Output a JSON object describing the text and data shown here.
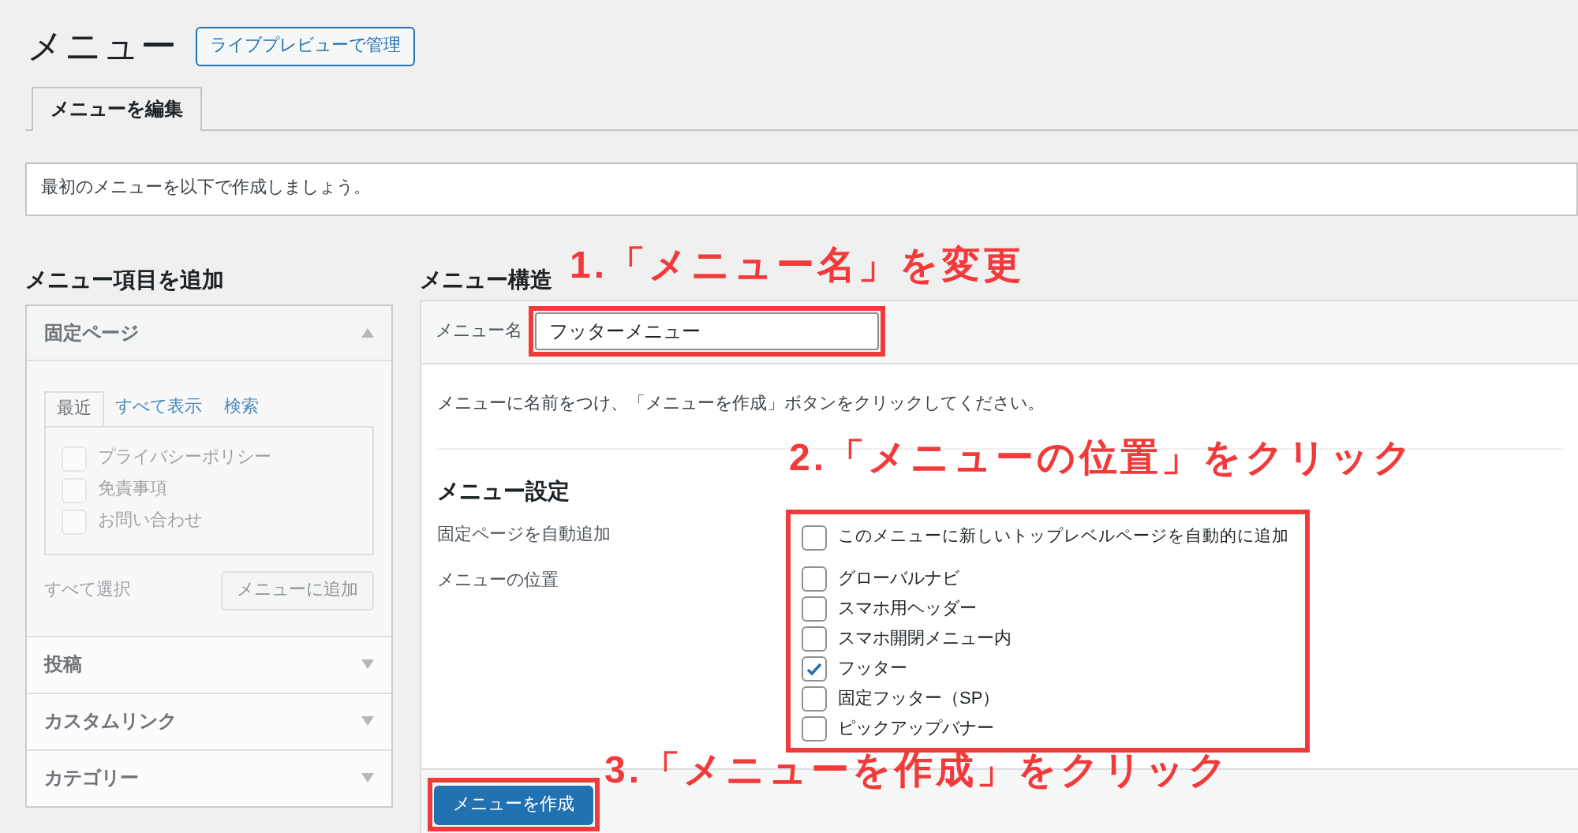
{
  "page_title": "メニュー",
  "live_preview_button": "ライブプレビューで管理",
  "tabs": [
    {
      "label": "メニューを編集",
      "selected": true
    }
  ],
  "notice": "最初のメニューを以下で作成しましょう。",
  "add_items": {
    "heading": "メニュー項目を追加",
    "disabled": true,
    "sections": [
      {
        "title": "固定ページ",
        "expanded": true,
        "tabs": [
          {
            "label": "最近",
            "selected": true
          },
          {
            "label": "すべて表示",
            "selected": false
          },
          {
            "label": "検索",
            "selected": false
          }
        ],
        "items": [
          {
            "label": "プライバシーポリシー",
            "checked": false
          },
          {
            "label": "免責事項",
            "checked": false
          },
          {
            "label": "お問い合わせ",
            "checked": false
          }
        ],
        "select_all": "すべて選択",
        "add_button": "メニューに追加"
      },
      {
        "title": "投稿",
        "expanded": false
      },
      {
        "title": "カスタムリンク",
        "expanded": false
      },
      {
        "title": "カテゴリー",
        "expanded": false
      }
    ]
  },
  "structure": {
    "heading": "メニュー構造",
    "name_label": "メニュー名",
    "name_value": "フッターメニュー",
    "description": "メニューに名前をつけ、「メニューを作成」ボタンをクリックしてください。",
    "settings_heading": "メニュー設定",
    "auto_add_label": "固定ページを自動追加",
    "auto_add": {
      "label": "このメニューに新しいトップレベルページを自動的に追加",
      "checked": false
    },
    "location_label": "メニューの位置",
    "locations": [
      {
        "label": "グローバルナビ",
        "checked": false
      },
      {
        "label": "スマホ用ヘッダー",
        "checked": false
      },
      {
        "label": "スマホ開閉メニュー内",
        "checked": false
      },
      {
        "label": "フッター",
        "checked": true
      },
      {
        "label": "固定フッター（SP）",
        "checked": false
      },
      {
        "label": "ピックアップバナー",
        "checked": false
      }
    ],
    "create_button": "メニューを作成"
  },
  "annotations": [
    "1.「メニュー名」を変更",
    "2.「メニューの位置」をクリック",
    "3.「メニューを作成」をクリック"
  ]
}
